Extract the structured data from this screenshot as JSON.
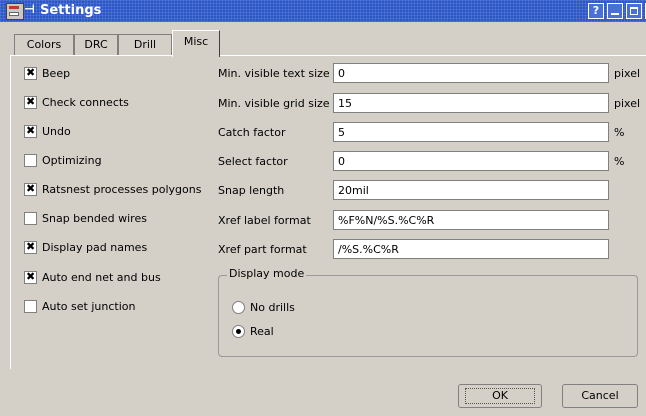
{
  "window": {
    "title": "Settings",
    "help": "?"
  },
  "tabs": [
    "Colors",
    "DRC",
    "Drill",
    "Misc"
  ],
  "checkboxes": [
    {
      "label": "Beep",
      "checked": true
    },
    {
      "label": "Check connects",
      "checked": true
    },
    {
      "label": "Undo",
      "checked": true
    },
    {
      "label": "Optimizing",
      "checked": false
    },
    {
      "label": "Ratsnest processes polygons",
      "checked": true
    },
    {
      "label": "Snap bended wires",
      "checked": false
    },
    {
      "label": "Display pad names",
      "checked": true
    },
    {
      "label": "Auto end net and bus",
      "checked": true
    },
    {
      "label": "Auto set junction",
      "checked": false
    }
  ],
  "fields": [
    {
      "label": "Min. visible text size",
      "value": "0",
      "unit": "pixel"
    },
    {
      "label": "Min. visible grid size",
      "value": "15",
      "unit": "pixel"
    },
    {
      "label": "Catch factor",
      "value": "5",
      "unit": "%"
    },
    {
      "label": "Select factor",
      "value": "0",
      "unit": "%"
    },
    {
      "label": "Snap length",
      "value": "20mil",
      "unit": ""
    },
    {
      "label": "Xref label format",
      "value": "%F%N/%S.%C%R",
      "unit": ""
    },
    {
      "label": "Xref part format",
      "value": "/%S.%C%R",
      "unit": ""
    }
  ],
  "display_mode": {
    "title": "Display mode",
    "options": [
      {
        "label": "No drills",
        "selected": false
      },
      {
        "label": "Real",
        "selected": true
      }
    ]
  },
  "buttons": {
    "ok": "OK",
    "cancel": "Cancel"
  }
}
